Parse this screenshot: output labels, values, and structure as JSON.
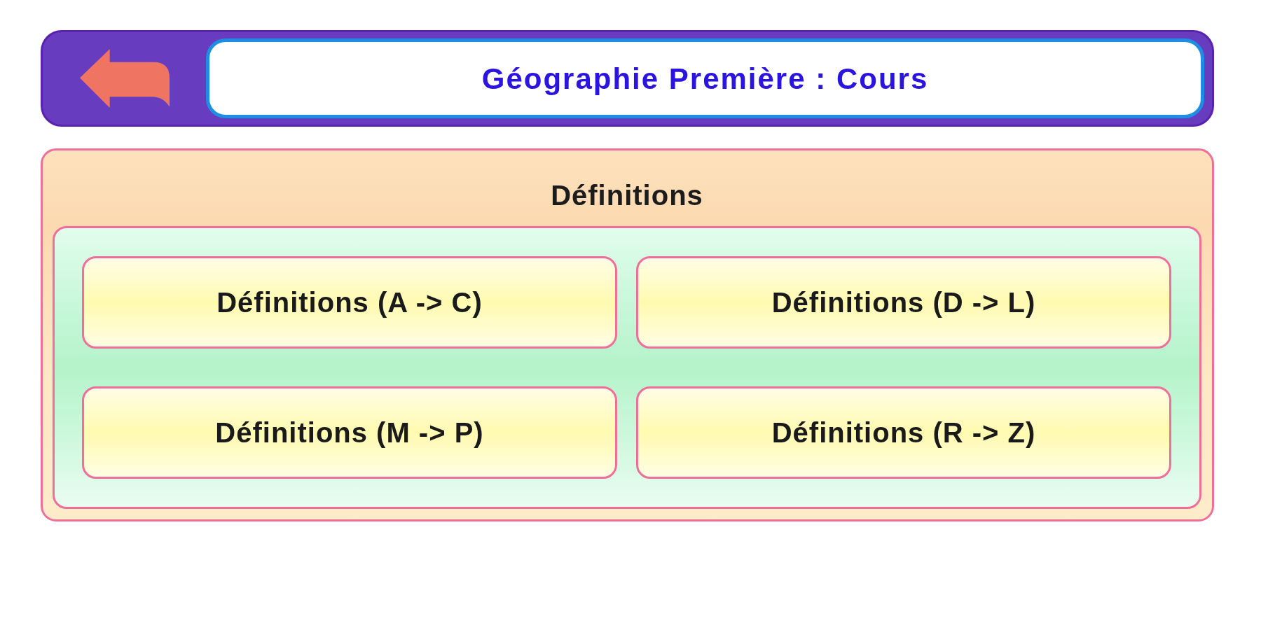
{
  "header": {
    "title": "Géographie Première : Cours"
  },
  "section": {
    "title": "Définitions",
    "buttons": [
      "Définitions (A -> C)",
      "Définitions (D -> L)",
      "Définitions (M -> P)",
      "Définitions (R -> Z)"
    ]
  }
}
